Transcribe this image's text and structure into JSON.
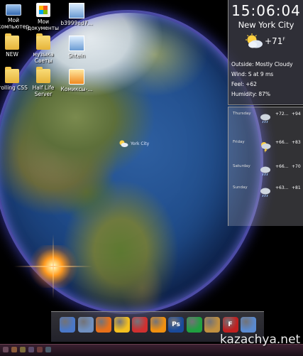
{
  "desktop": {
    "icons": [
      {
        "label": "Мой\nкомпьютер",
        "icon": "computer-icon"
      },
      {
        "label": "Мои\nдокументы",
        "icon": "documents-icon"
      },
      {
        "label": "b3999ed7...",
        "icon": "image-file-icon"
      },
      {
        "label": "NEW",
        "icon": "folder-icon"
      },
      {
        "label": "музыка\nСветы",
        "icon": "folder-icon"
      },
      {
        "label": "Shtein",
        "icon": "image-file-icon"
      },
      {
        "label": "Trolling CSS",
        "icon": "folder-icon"
      },
      {
        "label": "Half Life\nServer",
        "icon": "folder-icon"
      },
      {
        "label": "Комиксы-...",
        "icon": "application-icon"
      }
    ]
  },
  "globe": {
    "city_marker_label": "York City"
  },
  "weather": {
    "time": "15:06:04",
    "city": "New York City",
    "temp_now": "+71",
    "temp_unit": "F",
    "condition_icon": "partly-cloudy-icon",
    "outside": "Outside: Mostly Cloudy",
    "wind": "Wind: S at 9 ms",
    "feel": "Feel: +62",
    "humidity": "Humidity: 87%",
    "forecast": [
      {
        "day": "Thursday",
        "icon": "rain-icon",
        "high": "+72...",
        "low": "+94"
      },
      {
        "day": "Friday",
        "icon": "thunderstorm-icon",
        "high": "+66...",
        "low": "+83"
      },
      {
        "day": "Saturday",
        "icon": "rain-icon",
        "high": "+66...",
        "low": "+70"
      },
      {
        "day": "Sunday",
        "icon": "rain-icon",
        "high": "+63...",
        "low": "+81"
      }
    ]
  },
  "dock": {
    "items": [
      {
        "name": "computer-icon",
        "color": "#4a78c8",
        "glyph": ""
      },
      {
        "name": "display-settings-icon",
        "color": "#7090c0",
        "glyph": ""
      },
      {
        "name": "firefox-icon",
        "color": "#e8701a",
        "glyph": ""
      },
      {
        "name": "icq-icon",
        "color": "#f4c020",
        "glyph": ""
      },
      {
        "name": "picasa-icon",
        "color": "#d03030",
        "glyph": ""
      },
      {
        "name": "media-player-icon",
        "color": "#f09010",
        "glyph": ""
      },
      {
        "name": "photoshop-icon",
        "color": "#1a4a9a",
        "glyph": "Ps"
      },
      {
        "name": "browser-icon",
        "color": "#20a040",
        "glyph": ""
      },
      {
        "name": "archive-icon",
        "color": "#c09040",
        "glyph": ""
      },
      {
        "name": "filezilla-icon",
        "color": "#c02020",
        "glyph": "F"
      },
      {
        "name": "globe-icon",
        "color": "#5a8ad0",
        "glyph": ""
      }
    ]
  },
  "watermark": "kazachya.net"
}
